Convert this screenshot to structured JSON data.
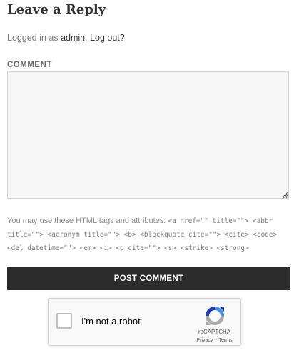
{
  "reply": {
    "title": "Leave a Reply",
    "logged_in_prefix": "Logged in as ",
    "user": "admin",
    "after_user": ". ",
    "logout": "Log out?"
  },
  "comment": {
    "label": "COMMENT",
    "value": ""
  },
  "allowed_tags": {
    "intro": "You may use these HTML tags and attributes: ",
    "tags": "<a href=\"\" title=\"\"> <abbr title=\"\"> <acronym title=\"\"> <b> <blockquote cite=\"\"> <cite> <code> <del datetime=\"\"> <em> <i> <q cite=\"\"> <s> <strike> <strong>"
  },
  "submit": {
    "label": "POST COMMENT"
  },
  "recaptcha": {
    "checkbox_label": "I'm not a robot",
    "brand": "reCAPTCHA",
    "privacy": "Privacy",
    "separator": "-",
    "terms": "Terms",
    "logo_icon": "recaptcha-logo-icon"
  }
}
